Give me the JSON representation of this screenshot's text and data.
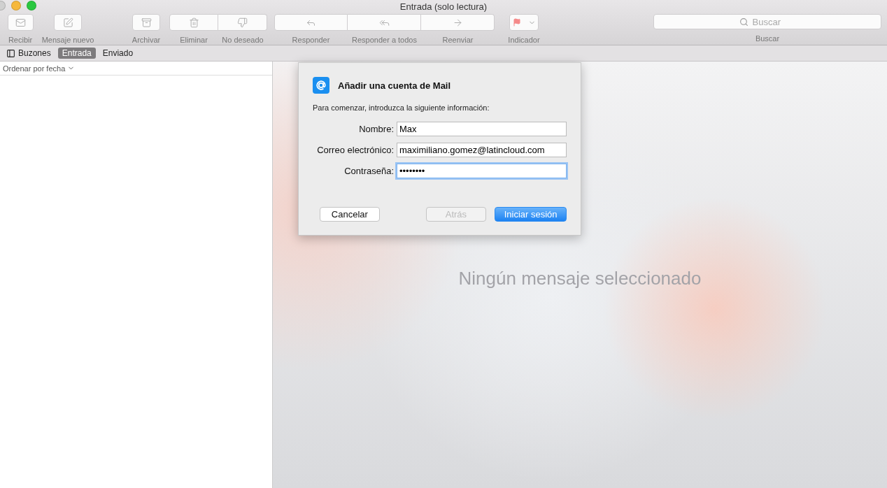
{
  "window": {
    "title": "Entrada (solo lectura)"
  },
  "toolbar": {
    "groups": [
      {
        "buttons": [
          {
            "label": "Recibir"
          }
        ]
      },
      {
        "buttons": [
          {
            "label": "Mensaje nuevo"
          }
        ]
      },
      {
        "buttons": [
          {
            "label": "Archivar"
          }
        ]
      },
      {
        "buttons": [
          {
            "label": "Eliminar"
          },
          {
            "label": "No deseado"
          }
        ]
      },
      {
        "buttons": [
          {
            "label": "Responder"
          },
          {
            "label": "Responder a todos"
          },
          {
            "label": "Reenviar"
          }
        ]
      },
      {
        "buttons": [
          {
            "label": "Indicador"
          }
        ]
      }
    ],
    "search": {
      "placeholder": "Buscar",
      "label": "Buscar"
    }
  },
  "mailbox_bar": [
    {
      "label": "Buzones",
      "selected": false
    },
    {
      "label": "Entrada",
      "selected": true
    },
    {
      "label": "Enviado",
      "selected": false
    }
  ],
  "message_list": {
    "sort": "Ordenar por fecha"
  },
  "viewer": {
    "empty_text": "Ningún mensaje seleccionado"
  },
  "dialog": {
    "title": "Añadir una cuenta de Mail",
    "intro": "Para comenzar, introduzca la siguiente información:",
    "fields": [
      {
        "label": "Nombre:",
        "value": "Max",
        "focused": false
      },
      {
        "label": "Correo electrónico:",
        "value": "maximiliano.gomez@latincloud.com",
        "focused": false
      },
      {
        "label": "Contraseña:",
        "value": "••••••••",
        "focused": true
      }
    ],
    "buttons": [
      {
        "label": "Cancelar",
        "disabled": false,
        "primary": false
      },
      {
        "label": "Atrás",
        "disabled": true,
        "primary": false
      },
      {
        "label": "Iniciar sesión",
        "disabled": false,
        "primary": true
      }
    ]
  }
}
